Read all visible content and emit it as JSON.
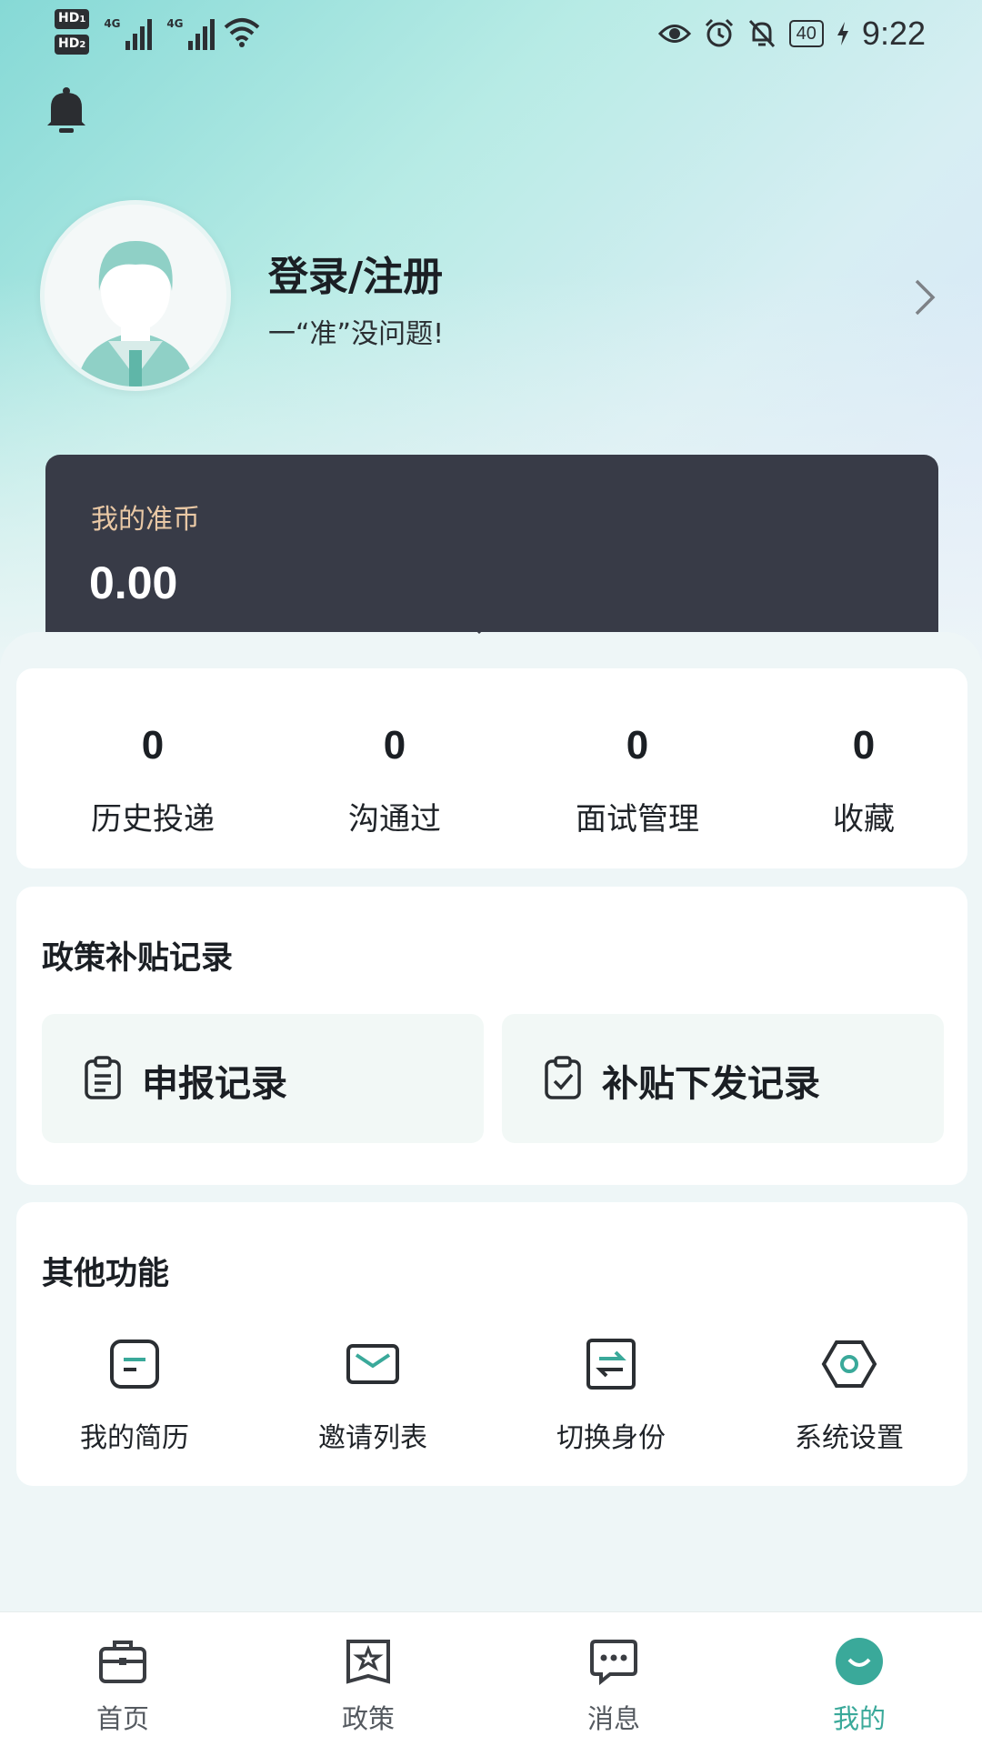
{
  "status_bar": {
    "hd1": "HD",
    "hd2": "HD",
    "hd1_sub": "1",
    "hd2_sub": "2",
    "net1": "4G",
    "net2": "4G",
    "battery": "40",
    "time": "9:22"
  },
  "header": {
    "icons": [
      "bell-icon"
    ]
  },
  "profile": {
    "title": "登录/注册",
    "subtitle": "一“准”没问题!"
  },
  "coin": {
    "label": "我的准币",
    "value": "0.00"
  },
  "stats": [
    {
      "value": "0",
      "label": "历史投递"
    },
    {
      "value": "0",
      "label": "沟通过"
    },
    {
      "value": "0",
      "label": "面试管理"
    },
    {
      "value": "0",
      "label": "收藏"
    }
  ],
  "policy": {
    "title": "政策补贴记录",
    "tiles": [
      {
        "label": "申报记录",
        "icon": "clipboard-icon"
      },
      {
        "label": "补贴下发记录",
        "icon": "clipboard-check-icon"
      }
    ]
  },
  "other": {
    "title": "其他功能",
    "items": [
      {
        "label": "我的简历",
        "icon": "resume-icon"
      },
      {
        "label": "邀请列表",
        "icon": "envelope-icon"
      },
      {
        "label": "切换身份",
        "icon": "switch-icon"
      },
      {
        "label": "系统设置",
        "icon": "settings-hex-icon"
      }
    ]
  },
  "nav": {
    "items": [
      {
        "label": "首页",
        "icon": "briefcase-icon"
      },
      {
        "label": "政策",
        "icon": "policy-star-icon"
      },
      {
        "label": "消息",
        "icon": "chat-icon"
      },
      {
        "label": "我的",
        "icon": "profile-face-icon"
      }
    ],
    "active_color": "#3aa99a"
  },
  "colors": {
    "accent": "#3aa99a",
    "coin_card": "#383b47",
    "coin_label": "#e9c8a5"
  }
}
